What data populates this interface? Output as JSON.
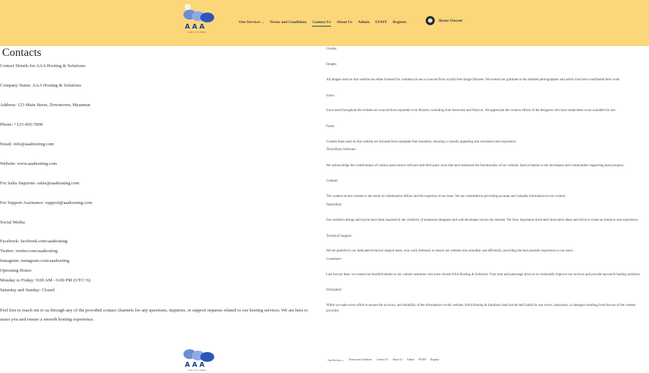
{
  "brand": {
    "wordmark": "AAA",
    "tagline": "SOLUTIONS"
  },
  "nav": {
    "items": [
      {
        "label": "Our Services",
        "chevron": "⌄"
      },
      {
        "label": "Terms and Conditions"
      },
      {
        "label": "Contact Us"
      },
      {
        "label": "About Us"
      },
      {
        "label": "Admin"
      },
      {
        "label": "STAFF"
      },
      {
        "label": "Register"
      }
    ],
    "user": {
      "name": "Jhonn Vincent",
      "icon": "user-icon"
    }
  },
  "contacts": {
    "title": "Contacts",
    "lines": [
      "Contact Details for AAA Hosting & Solutions:",
      "Company Name: AAA Hosting & Solutions",
      "Address: 123 Main Street, Downtown, Myanmar",
      "Phone: +123-456-7890",
      "Email: info@aaahosting.com",
      "Website: www.aaahosting.com",
      "For Sales Inquiries: sales@aaahosting.com",
      "For Support Assistance: support@aaahosting.com",
      "Social Media:",
      "Facebook: facebook.com/aaahosting",
      "Twitter: twitter.com/aaahosting",
      "Instagram: instagram.com/aaahosting",
      "Operating Hours:",
      "Monday to Friday: 9:00 AM - 6:00 PM (UTC+6)",
      "Saturday and Sunday: Closed"
    ],
    "closing": "Feel free to reach out to us through any of the provided contact channels for any questions, inquiries, or support requests related to our hosting services. We are here to assist you and ensure a smooth hosting experience."
  },
  "credits": [
    "Credits:",
    "Images:",
    "All images used on this website are either licensed for commercial use or sourced from royalty-free image libraries. We extend our gratitude to the talented photographers and artists who have contributed their work.",
    "Icons:",
    "Icons used throughout the website are sourced from reputable icon libraries, including Font Awesome and Flaticon. We appreciate the creative efforts of the designers who have made these icons available for use.",
    "Fonts:",
    "Custom fonts used on this website are licensed from reputable font foundries, ensuring a visually appealing and consistent user experience.",
    "Third-Party Software:",
    "We acknowledge the contributions of various open-source software and third-party tools that have enhanced the functionality of our website. Special thanks to the developers and communities supporting these projects.",
    "Content:",
    "The content on this website is the result of collaborative efforts and the expertise of our team. We are committed to providing accurate and valuable information to our visitors.",
    "Inspiration:",
    "Our website's design and layout have been inspired by the creativity of numerous designers and web developers across the internet. We draw inspiration from their innovative ideas and strive to create an intuitive user experience.",
    "Technical Support:",
    "We are grateful to our dedicated technical support team, who work tirelessly to ensure our website runs smoothly and efficiently, providing the best possible experience to our users.",
    "Customers:",
    "Last but not least, we extend our heartfelt thanks to our valued customers who have chosen AAA Hosting & Solutions. Your trust and patronage drive us to continually improve our services and provide top-notch hosting solutions.",
    "Disclaimer:",
    "While we make every effort to ensure the accuracy and reliability of the information on this website, AAA Hosting & Solutions shall not be held liable for any errors, omissions, or damages resulting from the use of the content provided."
  ],
  "footer": {
    "nav": [
      "Our Services ⌄",
      "Terms and Conditions",
      "Contact Us",
      "About Us",
      "Admin",
      "STAFF",
      "Register"
    ]
  }
}
